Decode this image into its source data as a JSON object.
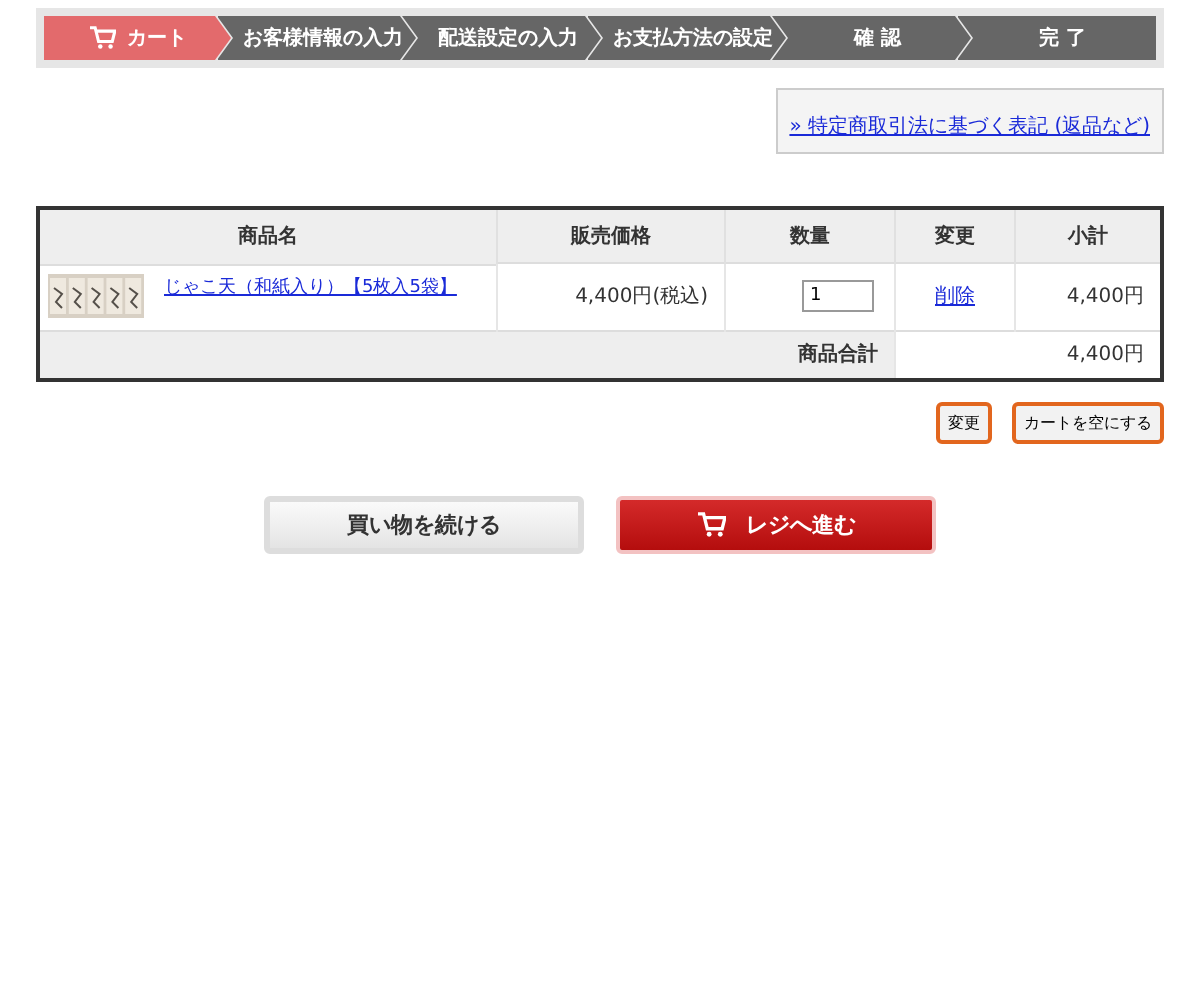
{
  "steps": [
    {
      "label": "カート",
      "selected": true
    },
    {
      "label": "お客様情報の入力",
      "selected": false
    },
    {
      "label": "配送設定の入力",
      "selected": false
    },
    {
      "label": "お支払方法の設定",
      "selected": false
    },
    {
      "label": "確 認",
      "selected": false
    },
    {
      "label": "完 了",
      "selected": false
    }
  ],
  "legal_link": "» 特定商取引法に基づく表記 (返品など)",
  "table": {
    "columns": [
      "商品名",
      "販売価格",
      "数量",
      "変更",
      "小計"
    ],
    "rows": [
      {
        "name": "じゃこ天（和紙入り）【5枚入5袋】",
        "price": "4,400円(税込)",
        "quantity": "1",
        "action": "削除",
        "subtotal": "4,400円"
      }
    ],
    "total_label": "商品合計",
    "total": "4,400円"
  },
  "small_buttons": [
    "変更",
    "カートを空にする"
  ],
  "continue_button": "買い物を続ける",
  "checkout_button": "レジへ進む"
}
